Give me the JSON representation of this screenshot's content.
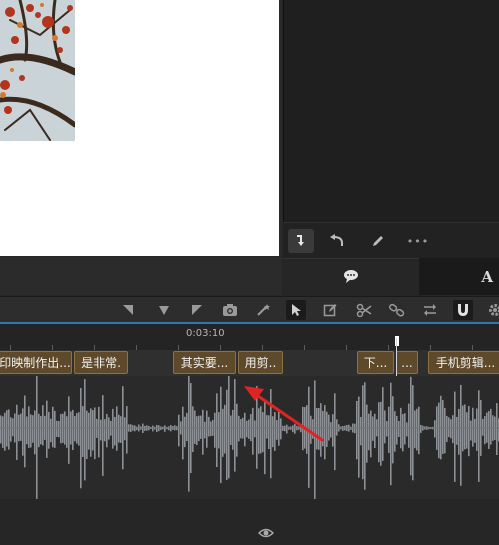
{
  "preview": {
    "footer_icon": "eye-icon"
  },
  "right_toolbar": {
    "icons": [
      "insert-icon",
      "undo-icon",
      "pen-icon",
      "more-icon"
    ],
    "more_label": "•••"
  },
  "right_tabs": {
    "comments_icon": "speech-bubble-icon",
    "text_label": "A"
  },
  "timeline_toolbar": {
    "icons": [
      "transition-left-icon",
      "marker-down-icon",
      "transition-right-icon",
      "snapshot-icon",
      "magic-wand-icon",
      "select-tool-icon",
      "edit-icon",
      "razor-icon",
      "link-icon",
      "swap-icon",
      "magnet-icon",
      "gear-icon"
    ]
  },
  "ruler": {
    "time_label": "0:03:10"
  },
  "clips": [
    {
      "label": "印映制作出..."
    },
    {
      "label": "是非常."
    },
    {
      "label": "其实要..."
    },
    {
      "label": "用剪.."
    },
    {
      "label": "下..."
    },
    {
      "label": "..."
    },
    {
      "label": "手机剪辑..."
    }
  ],
  "colors": {
    "accent_blue": "#2e78b8",
    "clip_fill": "#5e4a2a",
    "clip_border": "#8b7240",
    "waveform": "#8d9196",
    "arrow": "#e02424"
  }
}
